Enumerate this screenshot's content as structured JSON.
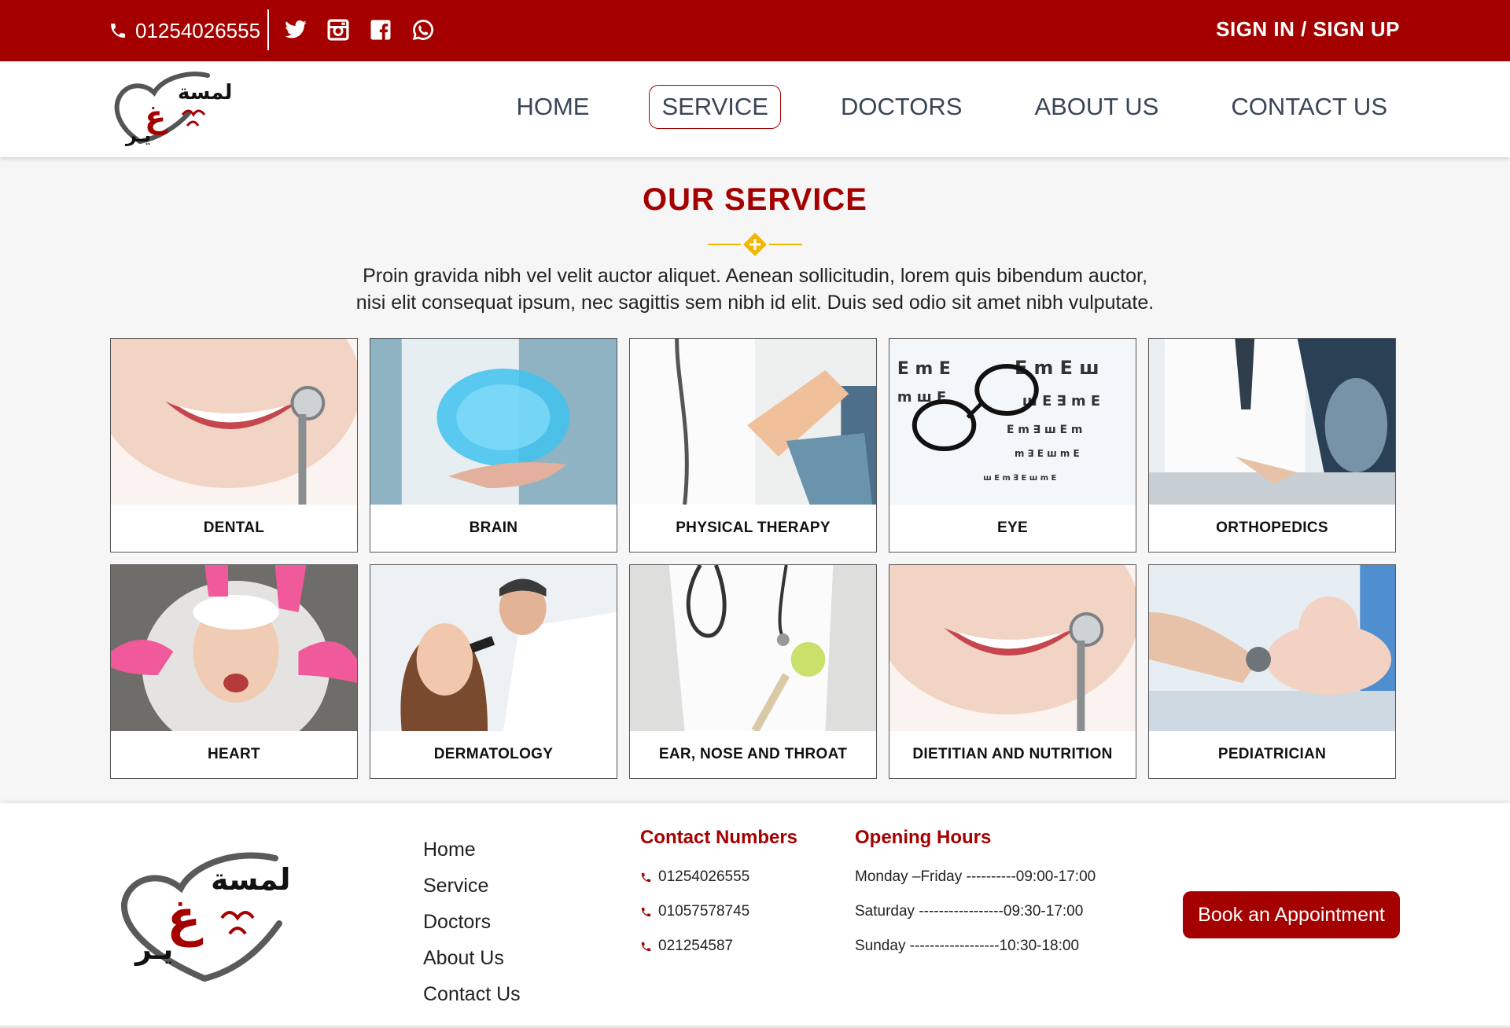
{
  "topbar": {
    "phone": "01254026555",
    "social_icons": [
      "twitter-icon",
      "instagram-icon",
      "facebook-icon",
      "whatsapp-icon"
    ],
    "auth_label": "SIGN IN / SIGN UP"
  },
  "nav": {
    "items": [
      {
        "label": "HOME",
        "active": false
      },
      {
        "label": "SERVICE",
        "active": true
      },
      {
        "label": "DOCTORS",
        "active": false
      },
      {
        "label": "ABOUT US",
        "active": false
      },
      {
        "label": "CONTACT US",
        "active": false
      }
    ]
  },
  "services": {
    "title": "OUR SERVICE",
    "intro_line1": "Proin gravida nibh vel velit auctor aliquet. Aenean sollicitudin, lorem quis bibendum auctor,",
    "intro_line2": "nisi elit consequat ipsum, nec sagittis sem nibh id elit. Duis sed odio sit amet nibh vulputate.",
    "items": [
      {
        "label": "DENTAL"
      },
      {
        "label": "BRAIN"
      },
      {
        "label": "PHYSICAL THERAPY"
      },
      {
        "label": "EYE"
      },
      {
        "label": "ORTHOPEDICS"
      },
      {
        "label": "HEART"
      },
      {
        "label": "DERMATOLOGY"
      },
      {
        "label": "EAR, NOSE AND THROAT"
      },
      {
        "label": "DIETITIAN AND NUTRITION"
      },
      {
        "label": "PEDIATRICIAN"
      }
    ]
  },
  "footer": {
    "links": [
      "Home",
      "Service",
      "Doctors",
      "About Us",
      "Contact Us"
    ],
    "contact_title": "Contact Numbers",
    "contacts": [
      "01254026555",
      "01057578745",
      "021254587"
    ],
    "hours_title": "Opening Hours",
    "hours": [
      "Monday –Friday ----------09:00-17:00",
      "Saturday -----------------09:30-17:00",
      "Sunday ------------------10:30-18:00"
    ],
    "book_label": "Book an Appointment"
  },
  "colors": {
    "brand": "#a50000",
    "accent": "#f2b705",
    "nav_text": "#3a4657"
  }
}
